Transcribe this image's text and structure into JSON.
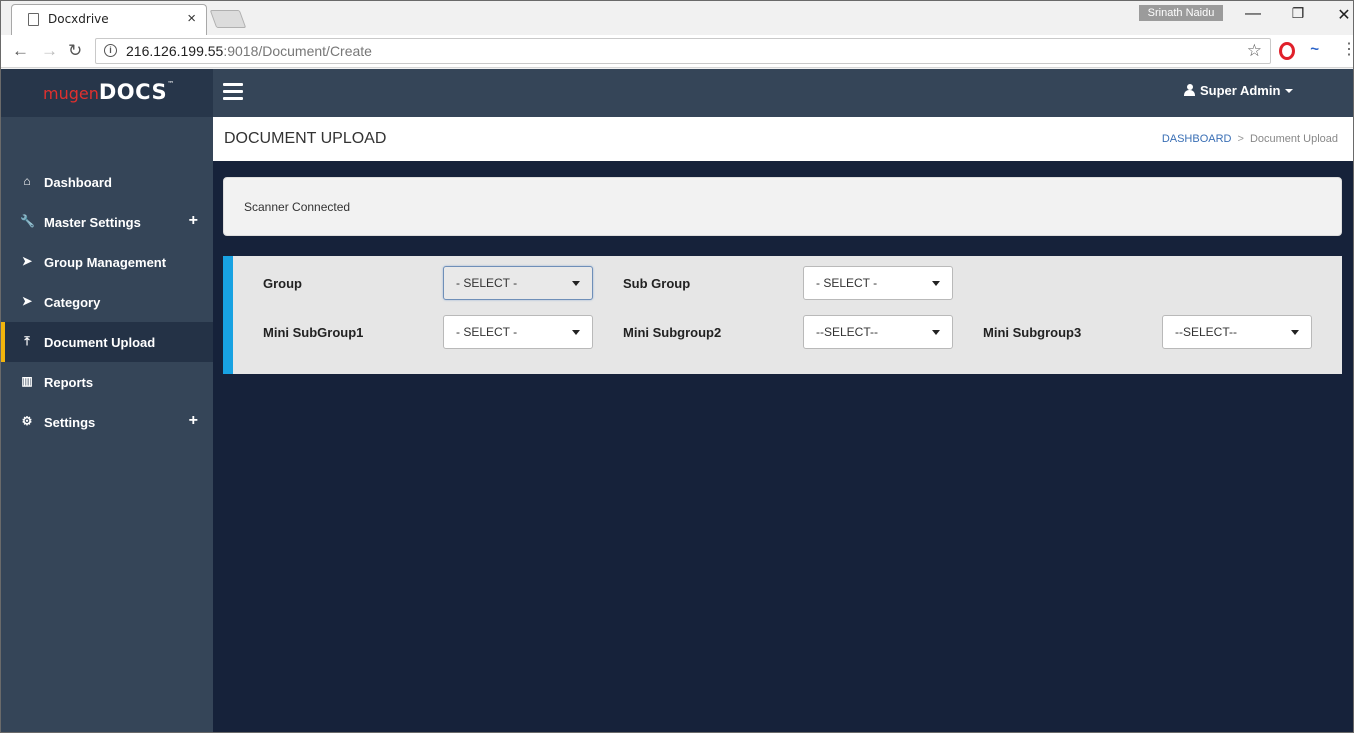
{
  "browser": {
    "tab_title": "Docxdrive",
    "tab_close": "×",
    "profile_name": "Srinath Naidu",
    "url_host": "216.126.199.55",
    "url_path": ":9018/Document/Create",
    "window_controls": {
      "minimize": "—",
      "restore": "❐",
      "close": "✕"
    }
  },
  "app": {
    "logo_prefix": "mugen",
    "logo_main": "DOCS",
    "logo_tm": "™",
    "user_name": "Super Admin"
  },
  "sidebar": {
    "items": [
      {
        "label": "Dashboard",
        "icon": "home-icon",
        "glyph": "⌂",
        "expand": ""
      },
      {
        "label": "Master Settings",
        "icon": "wrench-icon",
        "glyph": "🔧",
        "expand": "+"
      },
      {
        "label": "Group Management",
        "icon": "send-icon",
        "glyph": "➤",
        "expand": ""
      },
      {
        "label": "Category",
        "icon": "send-icon",
        "glyph": "➤",
        "expand": ""
      },
      {
        "label": "Document Upload",
        "icon": "upload-icon",
        "glyph": "⤒",
        "expand": "",
        "active": true
      },
      {
        "label": "Reports",
        "icon": "bar-chart-icon",
        "glyph": "▥",
        "expand": ""
      },
      {
        "label": "Settings",
        "icon": "gear-icon",
        "glyph": "⚙",
        "expand": "+"
      }
    ]
  },
  "page": {
    "title": "DOCUMENT UPLOAD",
    "breadcrumb_home": "DASHBOARD",
    "breadcrumb_sep": ">",
    "breadcrumb_current": "Document Upload",
    "status": "Scanner Connected"
  },
  "form": {
    "group": {
      "label": "Group",
      "value": "- SELECT -"
    },
    "sub_group": {
      "label": "Sub Group",
      "value": "- SELECT -"
    },
    "mini_subgroup1": {
      "label": "Mini SubGroup1",
      "value": "- SELECT -"
    },
    "mini_subgroup2": {
      "label": "Mini Subgroup2",
      "value": "--SELECT--"
    },
    "mini_subgroup3": {
      "label": "Mini Subgroup3",
      "value": "--SELECT--"
    }
  },
  "colors": {
    "sidebar_bg": "#354558",
    "content_bg": "#16223a",
    "accent_active": "#f2b40c",
    "panel_accent": "#18a2e2"
  }
}
